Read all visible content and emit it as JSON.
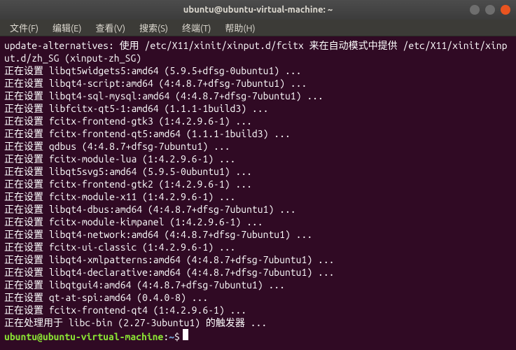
{
  "titlebar": {
    "title": "ubuntu@ubuntu-virtual-machine: ~"
  },
  "menubar": {
    "items": [
      "文件(F)",
      "编辑(E)",
      "查看(V)",
      "搜索(S)",
      "终端(T)",
      "帮助(H)"
    ]
  },
  "terminal": {
    "lines": [
      "update-alternatives: 使用 /etc/X11/xinit/xinput.d/fcitx 来在自动模式中提供 /etc/X11/xinit/xinput.d/zh_SG (xinput-zh_SG)",
      "正在设置 libqt5widgets5:amd64 (5.9.5+dfsg-0ubuntu1) ...",
      "正在设置 libqt4-script:amd64 (4:4.8.7+dfsg-7ubuntu1) ...",
      "正在设置 libqt4-sql-mysql:amd64 (4:4.8.7+dfsg-7ubuntu1) ...",
      "正在设置 libfcitx-qt5-1:amd64 (1.1.1-1build3) ...",
      "正在设置 fcitx-frontend-gtk3 (1:4.2.9.6-1) ...",
      "正在设置 fcitx-frontend-qt5:amd64 (1.1.1-1build3) ...",
      "正在设置 qdbus (4:4.8.7+dfsg-7ubuntu1) ...",
      "正在设置 fcitx-module-lua (1:4.2.9.6-1) ...",
      "正在设置 libqt5svg5:amd64 (5.9.5-0ubuntu1) ...",
      "正在设置 fcitx-frontend-gtk2 (1:4.2.9.6-1) ...",
      "正在设置 fcitx-module-x11 (1:4.2.9.6-1) ...",
      "正在设置 libqt4-dbus:amd64 (4:4.8.7+dfsg-7ubuntu1) ...",
      "正在设置 fcitx-module-kimpanel (1:4.2.9.6-1) ...",
      "正在设置 libqt4-network:amd64 (4:4.8.7+dfsg-7ubuntu1) ...",
      "正在设置 fcitx-ui-classic (1:4.2.9.6-1) ...",
      "正在设置 libqt4-xmlpatterns:amd64 (4:4.8.7+dfsg-7ubuntu1) ...",
      "正在设置 libqt4-declarative:amd64 (4:4.8.7+dfsg-7ubuntu1) ...",
      "正在设置 libqtgui4:amd64 (4:4.8.7+dfsg-7ubuntu1) ...",
      "正在设置 qt-at-spi:amd64 (0.4.0-8) ...",
      "正在设置 fcitx-frontend-qt4 (1:4.2.9.6-1) ...",
      "正在处理用于 libc-bin (2.27-3ubuntu1) 的触发器 ..."
    ],
    "prompt": {
      "user_host": "ubuntu@ubuntu-virtual-machine",
      "colon": ":",
      "path": "~",
      "dollar": "$"
    }
  }
}
